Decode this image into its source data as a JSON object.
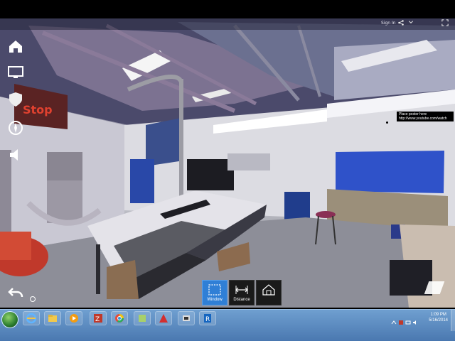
{
  "viewer": {
    "signin_label": "Sign In",
    "annotation": {
      "line1": "Place poster here",
      "line2": "http://www.youtube.com/watch"
    },
    "wall_sign_text": "Stop"
  },
  "left_toolbar": {
    "items": [
      {
        "name": "home-icon"
      },
      {
        "name": "monitor-icon"
      },
      {
        "name": "shield-icon"
      },
      {
        "name": "compass-icon"
      },
      {
        "name": "speaker-icon"
      },
      {
        "name": "undo-icon"
      }
    ]
  },
  "tools": {
    "window_label": "Window",
    "distance_label": "Distance",
    "third_label": ""
  },
  "taskbar": {
    "time": "1:09 PM",
    "date": "5/16/2014"
  },
  "colors": {
    "accent": "#2f7fd6",
    "taskbar": "#4a78b0"
  }
}
